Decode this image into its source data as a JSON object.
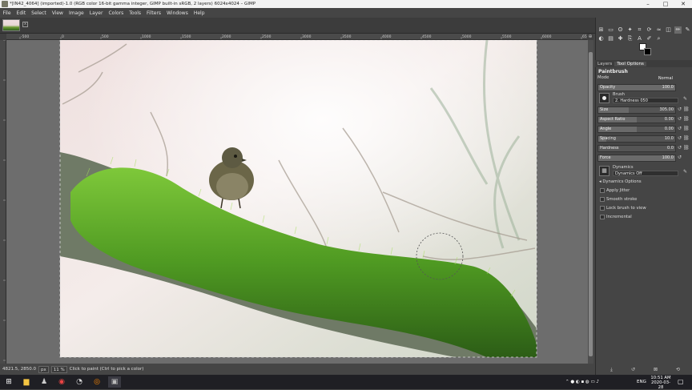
{
  "window": {
    "title": "*[IN42_4064] (imported)-1.0 (RGB color 16-bit gamma integer, GIMP built-in sRGB, 2 layers) 6024x4024 – GIMP",
    "controls": [
      "–",
      "□",
      "✕"
    ]
  },
  "menu": [
    "File",
    "Edit",
    "Select",
    "View",
    "Image",
    "Layer",
    "Colors",
    "Tools",
    "Filters",
    "Windows",
    "Help"
  ],
  "image_tab": {
    "close": "x"
  },
  "ruler": {
    "h_ticks": [
      "-500",
      "0",
      "500",
      "1000",
      "1500",
      "2000",
      "2500",
      "3000",
      "3500",
      "4000",
      "4500",
      "5000",
      "5500",
      "6000",
      "6500"
    ]
  },
  "status": {
    "coords": "4821.5, 2850.0",
    "unit": "px",
    "zoom": "11 %",
    "message": "Click to paint (Ctrl to pick a color)"
  },
  "panel": {
    "tabs": [
      "Layers",
      "Tool Options"
    ],
    "tool_name": "Paintbrush",
    "mode_label": "Mode",
    "mode_value": "Normal",
    "opacity": {
      "label": "Opacity",
      "value": "100.0"
    },
    "brush_label": "Brush",
    "brush_value": "2. Hardness 050",
    "size": {
      "label": "Size",
      "value": "305.00",
      "fill": 0.4
    },
    "aspect": {
      "label": "Aspect Ratio",
      "value": "0.00",
      "fill": 0.5
    },
    "angle": {
      "label": "Angle",
      "value": "0.00",
      "fill": 0.5
    },
    "spacing": {
      "label": "Spacing",
      "value": "10.0",
      "fill": 0.1
    },
    "hardness": {
      "label": "Hardness",
      "value": "0.0",
      "fill": 0.0
    },
    "force": {
      "label": "Force",
      "value": "100.0",
      "fill": 1.0
    },
    "dynamics_label": "Dynamics",
    "dynamics_value": "Dynamics Off",
    "dynamics_options": "Dynamics Options",
    "checks": [
      "Apply Jitter",
      "Smooth stroke",
      "Lock brush to view",
      "Incremental"
    ]
  },
  "taskbar": {
    "lang": "ENG",
    "time": "10:51 AM",
    "date": "2020-03-28"
  },
  "colors": {
    "fg": "#ffffff",
    "bg": "#000000",
    "accent": "#6aa52a"
  }
}
